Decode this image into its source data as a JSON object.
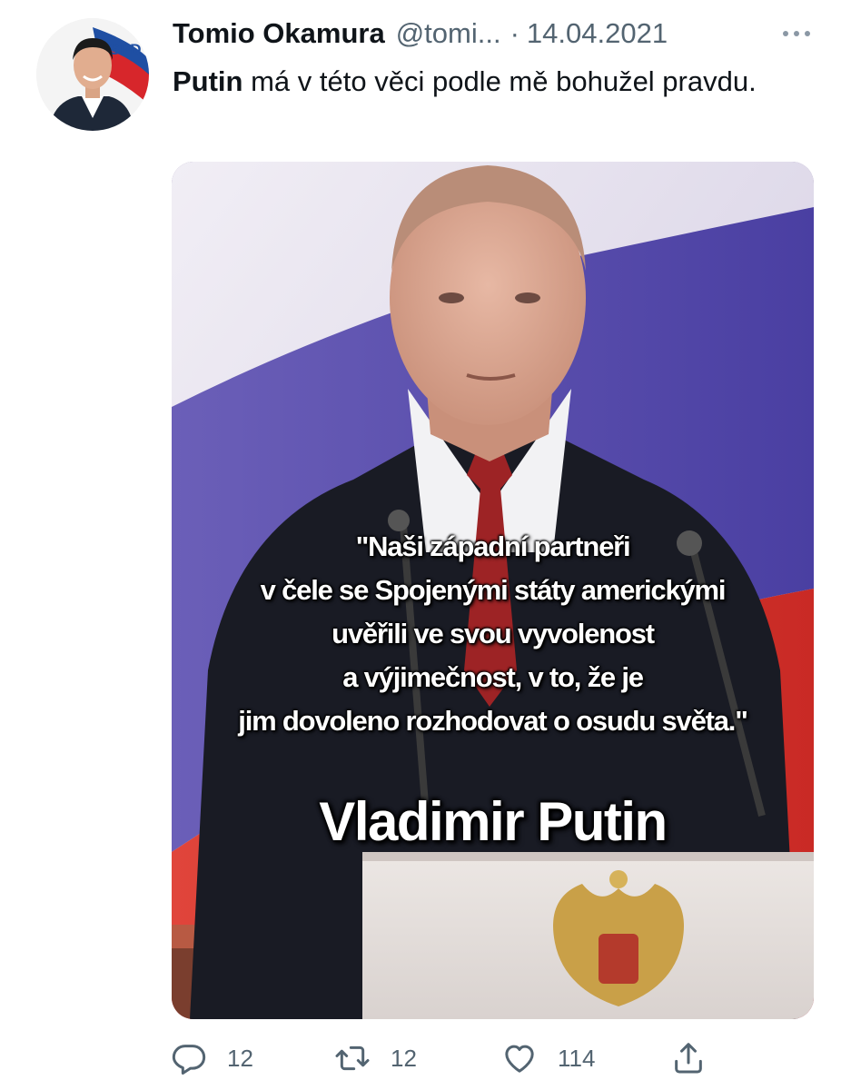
{
  "tweet": {
    "author": {
      "display_name": "Tomio Okamura",
      "handle": "@tomi...",
      "avatar_badge": "SPD"
    },
    "separator": "·",
    "date": "14.04.2021",
    "text_bold": "Putin",
    "text_rest": " má v této věci podle mě bohužel pravdu.",
    "media": {
      "quote_lines": [
        "\"Naši západní partneři",
        "v čele se Spojenými státy americkými",
        "uvěřili ve svou vyvolenost",
        "a výjimečnost, v to, že je",
        "jim dovoleno rozhodovat o osudu světa.\""
      ],
      "attribution": "Vladimir Putin"
    },
    "actions": {
      "reply_count": "12",
      "retweet_count": "12",
      "like_count": "114"
    }
  },
  "icons": {
    "more": "more-horizontal-icon",
    "reply": "reply-icon",
    "retweet": "retweet-icon",
    "like": "heart-icon",
    "share": "share-icon"
  },
  "colors": {
    "text_primary": "#0f1419",
    "text_secondary": "#536471",
    "flag_white": "#e6e2ee",
    "flag_blue": "#5b4fb0",
    "flag_red": "#d8382f"
  }
}
